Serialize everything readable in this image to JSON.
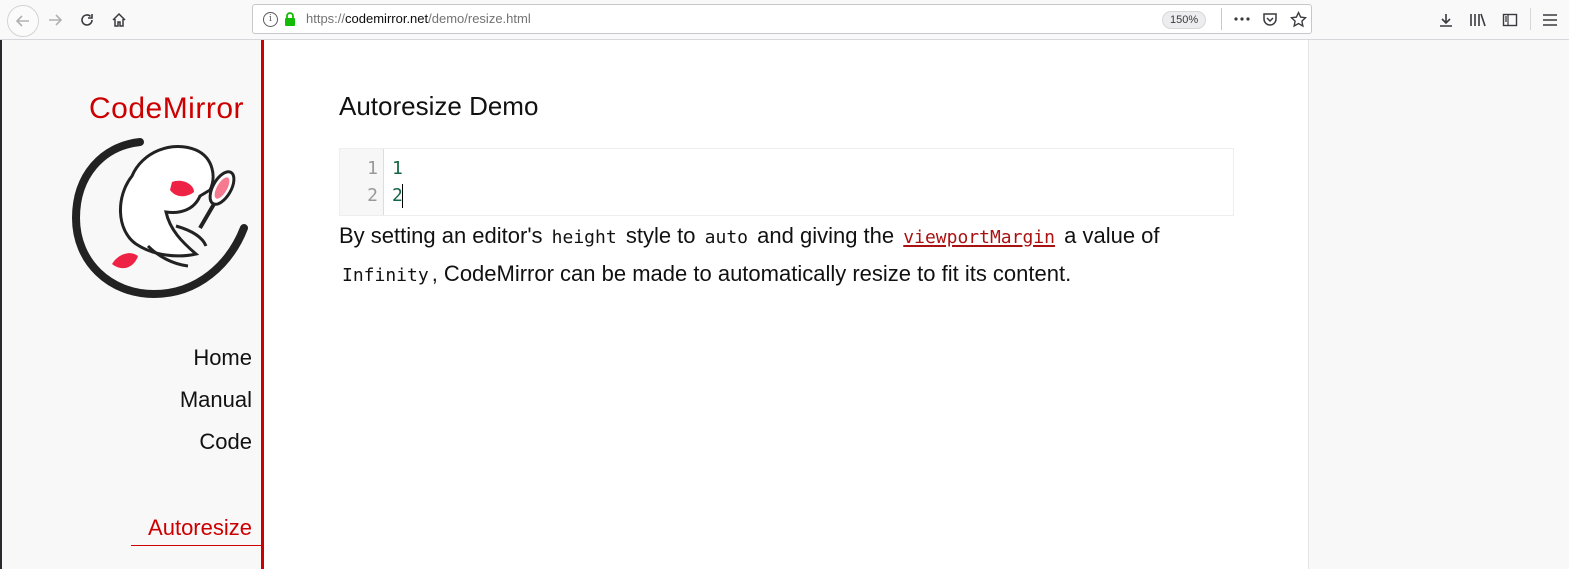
{
  "browser": {
    "url_prefix": "https://",
    "url_host": "codemirror.net",
    "url_path": "/demo/resize.html",
    "zoom": "150%"
  },
  "sidebar": {
    "logo_text": "CodeMirror",
    "nav": [
      "Home",
      "Manual",
      "Code"
    ],
    "active": "Autoresize"
  },
  "content": {
    "title": "Autoresize Demo",
    "editor_lines": [
      {
        "num": "1",
        "code": "1"
      },
      {
        "num": "2",
        "code": "2"
      }
    ],
    "desc": {
      "t1": "By setting an editor's",
      "c1": "height",
      "t2": "style to",
      "c2": "auto",
      "t3": "and giving the",
      "link": "viewportMargin",
      "t4": "a value of",
      "c3": "Infinity",
      "t5": ", CodeMirror can be made to automatically resize to fit its content."
    }
  },
  "colors": {
    "accent": "#cc0000",
    "link": "#aa1111",
    "code_number": "#116644"
  }
}
